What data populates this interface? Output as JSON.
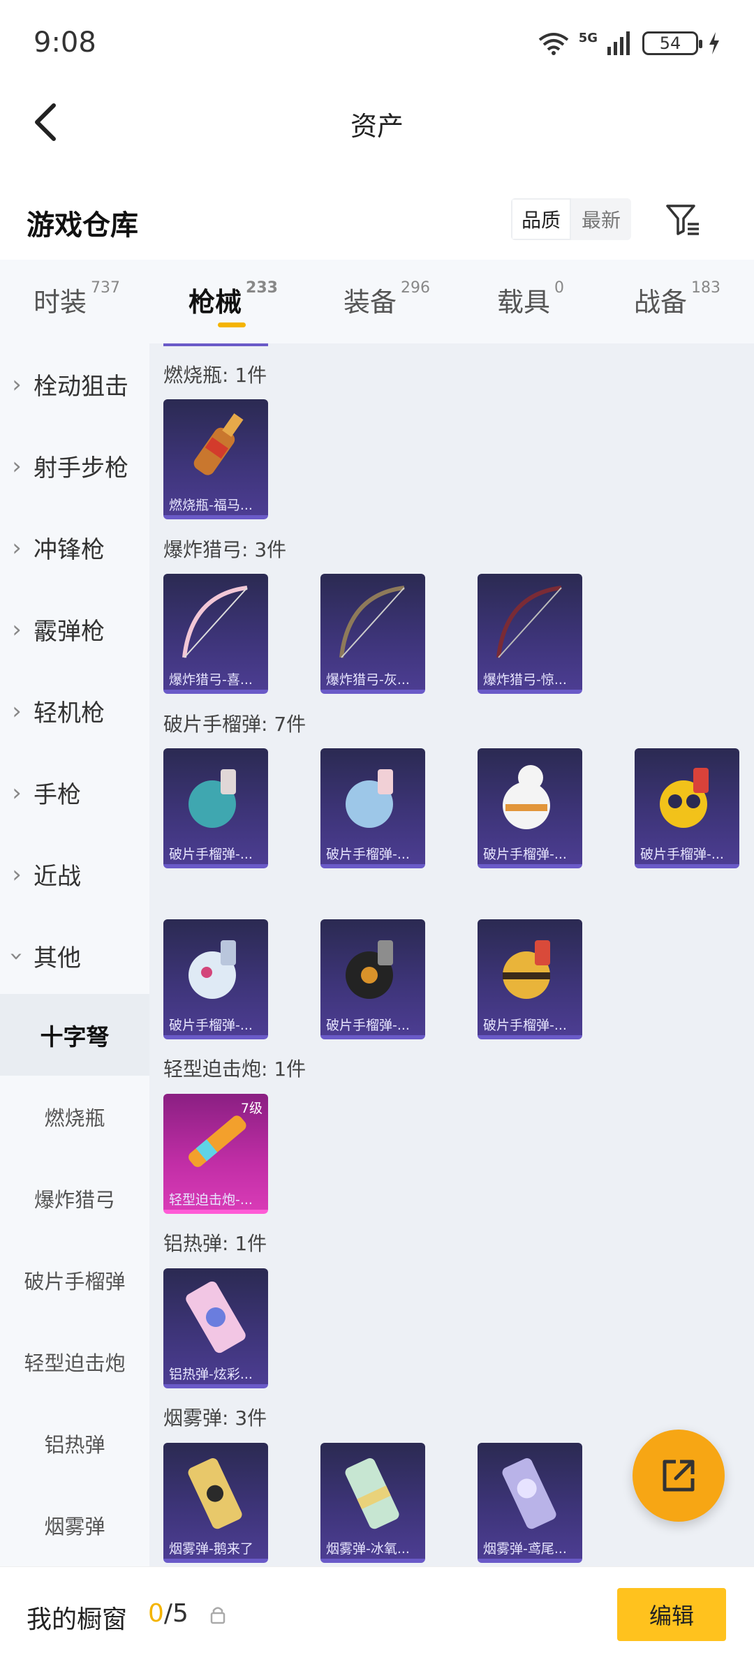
{
  "status": {
    "time": "9:08",
    "network": "5G",
    "battery": "54"
  },
  "nav": {
    "title": "资产"
  },
  "header": {
    "title": "游戏仓库",
    "sort_options": [
      "品质",
      "最新"
    ],
    "sort_active": "品质"
  },
  "tabs": [
    {
      "label": "时装",
      "count": "737"
    },
    {
      "label": "枪械",
      "count": "233",
      "active": true
    },
    {
      "label": "装备",
      "count": "296"
    },
    {
      "label": "载具",
      "count": "0"
    },
    {
      "label": "战备",
      "count": "183"
    }
  ],
  "sidebar": {
    "categories": [
      "栓动狙击",
      "射手步枪",
      "冲锋枪",
      "霰弹枪",
      "轻机枪",
      "手枪",
      "近战",
      "其他"
    ],
    "subcategories": [
      "十字弩",
      "燃烧瓶",
      "爆炸猎弓",
      "破片手榴弹",
      "轻型迫击炮",
      "铝热弹",
      "烟雾弹"
    ],
    "active_sub": "十字弩"
  },
  "groups": [
    {
      "label": "燃烧瓶: 1件",
      "items": [
        "燃烧瓶-福马..."
      ]
    },
    {
      "label": "爆炸猎弓: 3件",
      "items": [
        "爆炸猎弓-喜...",
        "爆炸猎弓-灰...",
        "爆炸猎弓-惊..."
      ]
    },
    {
      "label": "破片手榴弹: 7件",
      "items": [
        "破片手榴弹-...",
        "破片手榴弹-...",
        "破片手榴弹-...",
        "破片手榴弹-...",
        "破片手榴弹-...",
        "破片手榴弹-...",
        "破片手榴弹-..."
      ]
    },
    {
      "label": "轻型迫击炮: 1件",
      "items": [
        "轻型迫击炮-..."
      ],
      "level": "7级"
    },
    {
      "label": "铝热弹: 1件",
      "items": [
        "铝热弹-炫彩..."
      ]
    },
    {
      "label": "烟雾弹: 3件",
      "items": [
        "烟雾弹-鹅来了",
        "烟雾弹-冰氧...",
        "烟雾弹-鸢尾..."
      ]
    }
  ],
  "bottom": {
    "showcase_label": "我的橱窗",
    "current": "0",
    "total": "/5",
    "edit_label": "编辑"
  },
  "colors": {
    "accent": "#f4b400",
    "fab": "#f7a614",
    "edit": "#ffc21e"
  }
}
